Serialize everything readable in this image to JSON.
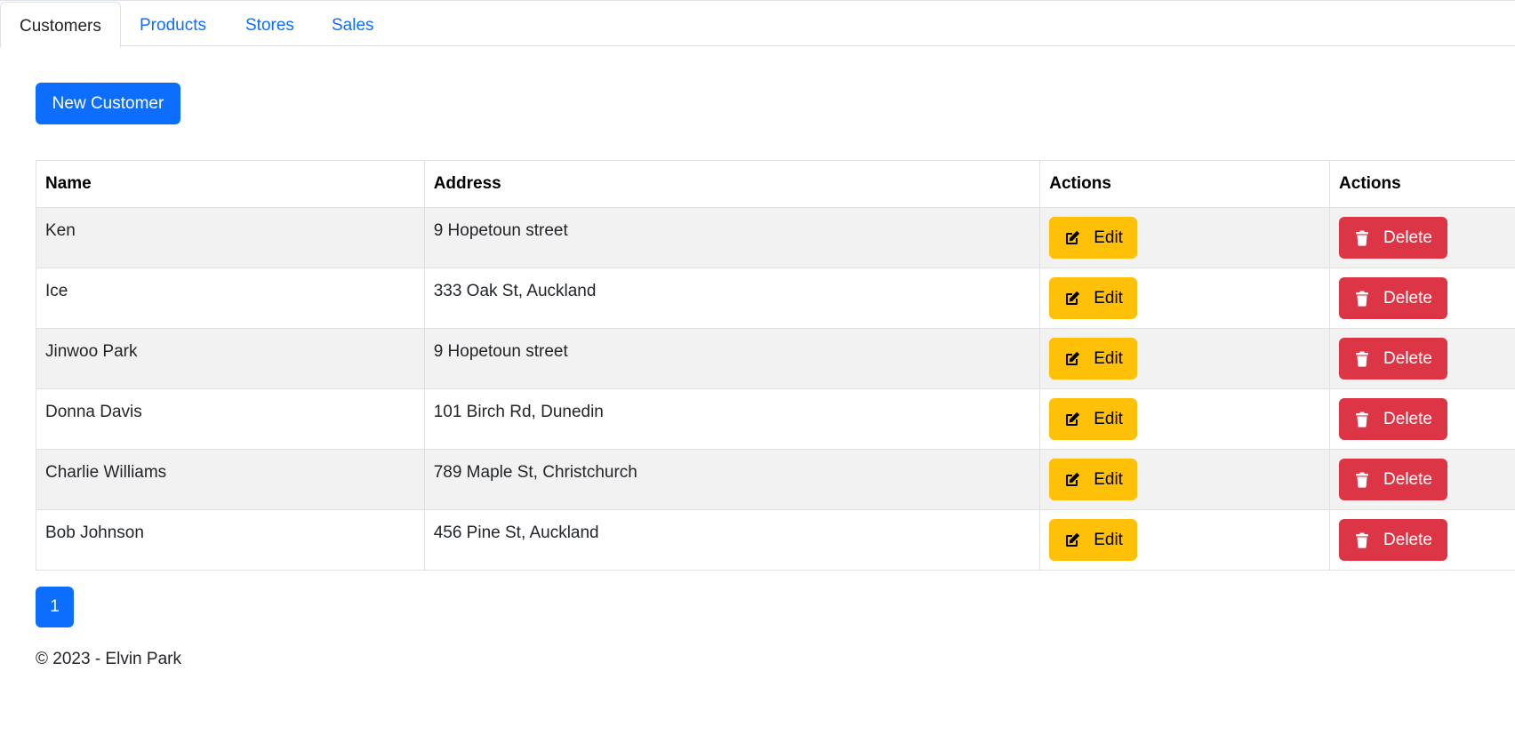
{
  "tabs": [
    {
      "label": "Customers"
    },
    {
      "label": "Products"
    },
    {
      "label": "Stores"
    },
    {
      "label": "Sales"
    }
  ],
  "new_button": {
    "label": "New Customer"
  },
  "table": {
    "headers": [
      "Name",
      "Address",
      "Actions",
      "Actions"
    ],
    "rows": [
      {
        "name": "Ken",
        "address": "9 Hopetoun street"
      },
      {
        "name": "Ice",
        "address": "333 Oak St, Auckland"
      },
      {
        "name": "Jinwoo Park",
        "address": "9 Hopetoun street"
      },
      {
        "name": "Donna Davis",
        "address": "101 Birch Rd, Dunedin"
      },
      {
        "name": "Charlie Williams",
        "address": "789 Maple St, Christchurch"
      },
      {
        "name": "Bob Johnson",
        "address": "456 Pine St, Auckland"
      }
    ],
    "edit_label": "Edit",
    "delete_label": "Delete",
    "edit_icon": "edit-icon",
    "delete_icon": "trash-icon"
  },
  "pagination": {
    "current": "1"
  },
  "footer": {
    "text": "© 2023 - Elvin Park"
  },
  "colors": {
    "primary": "#0d6efd",
    "warning": "#ffc107",
    "danger": "#dc3545"
  }
}
